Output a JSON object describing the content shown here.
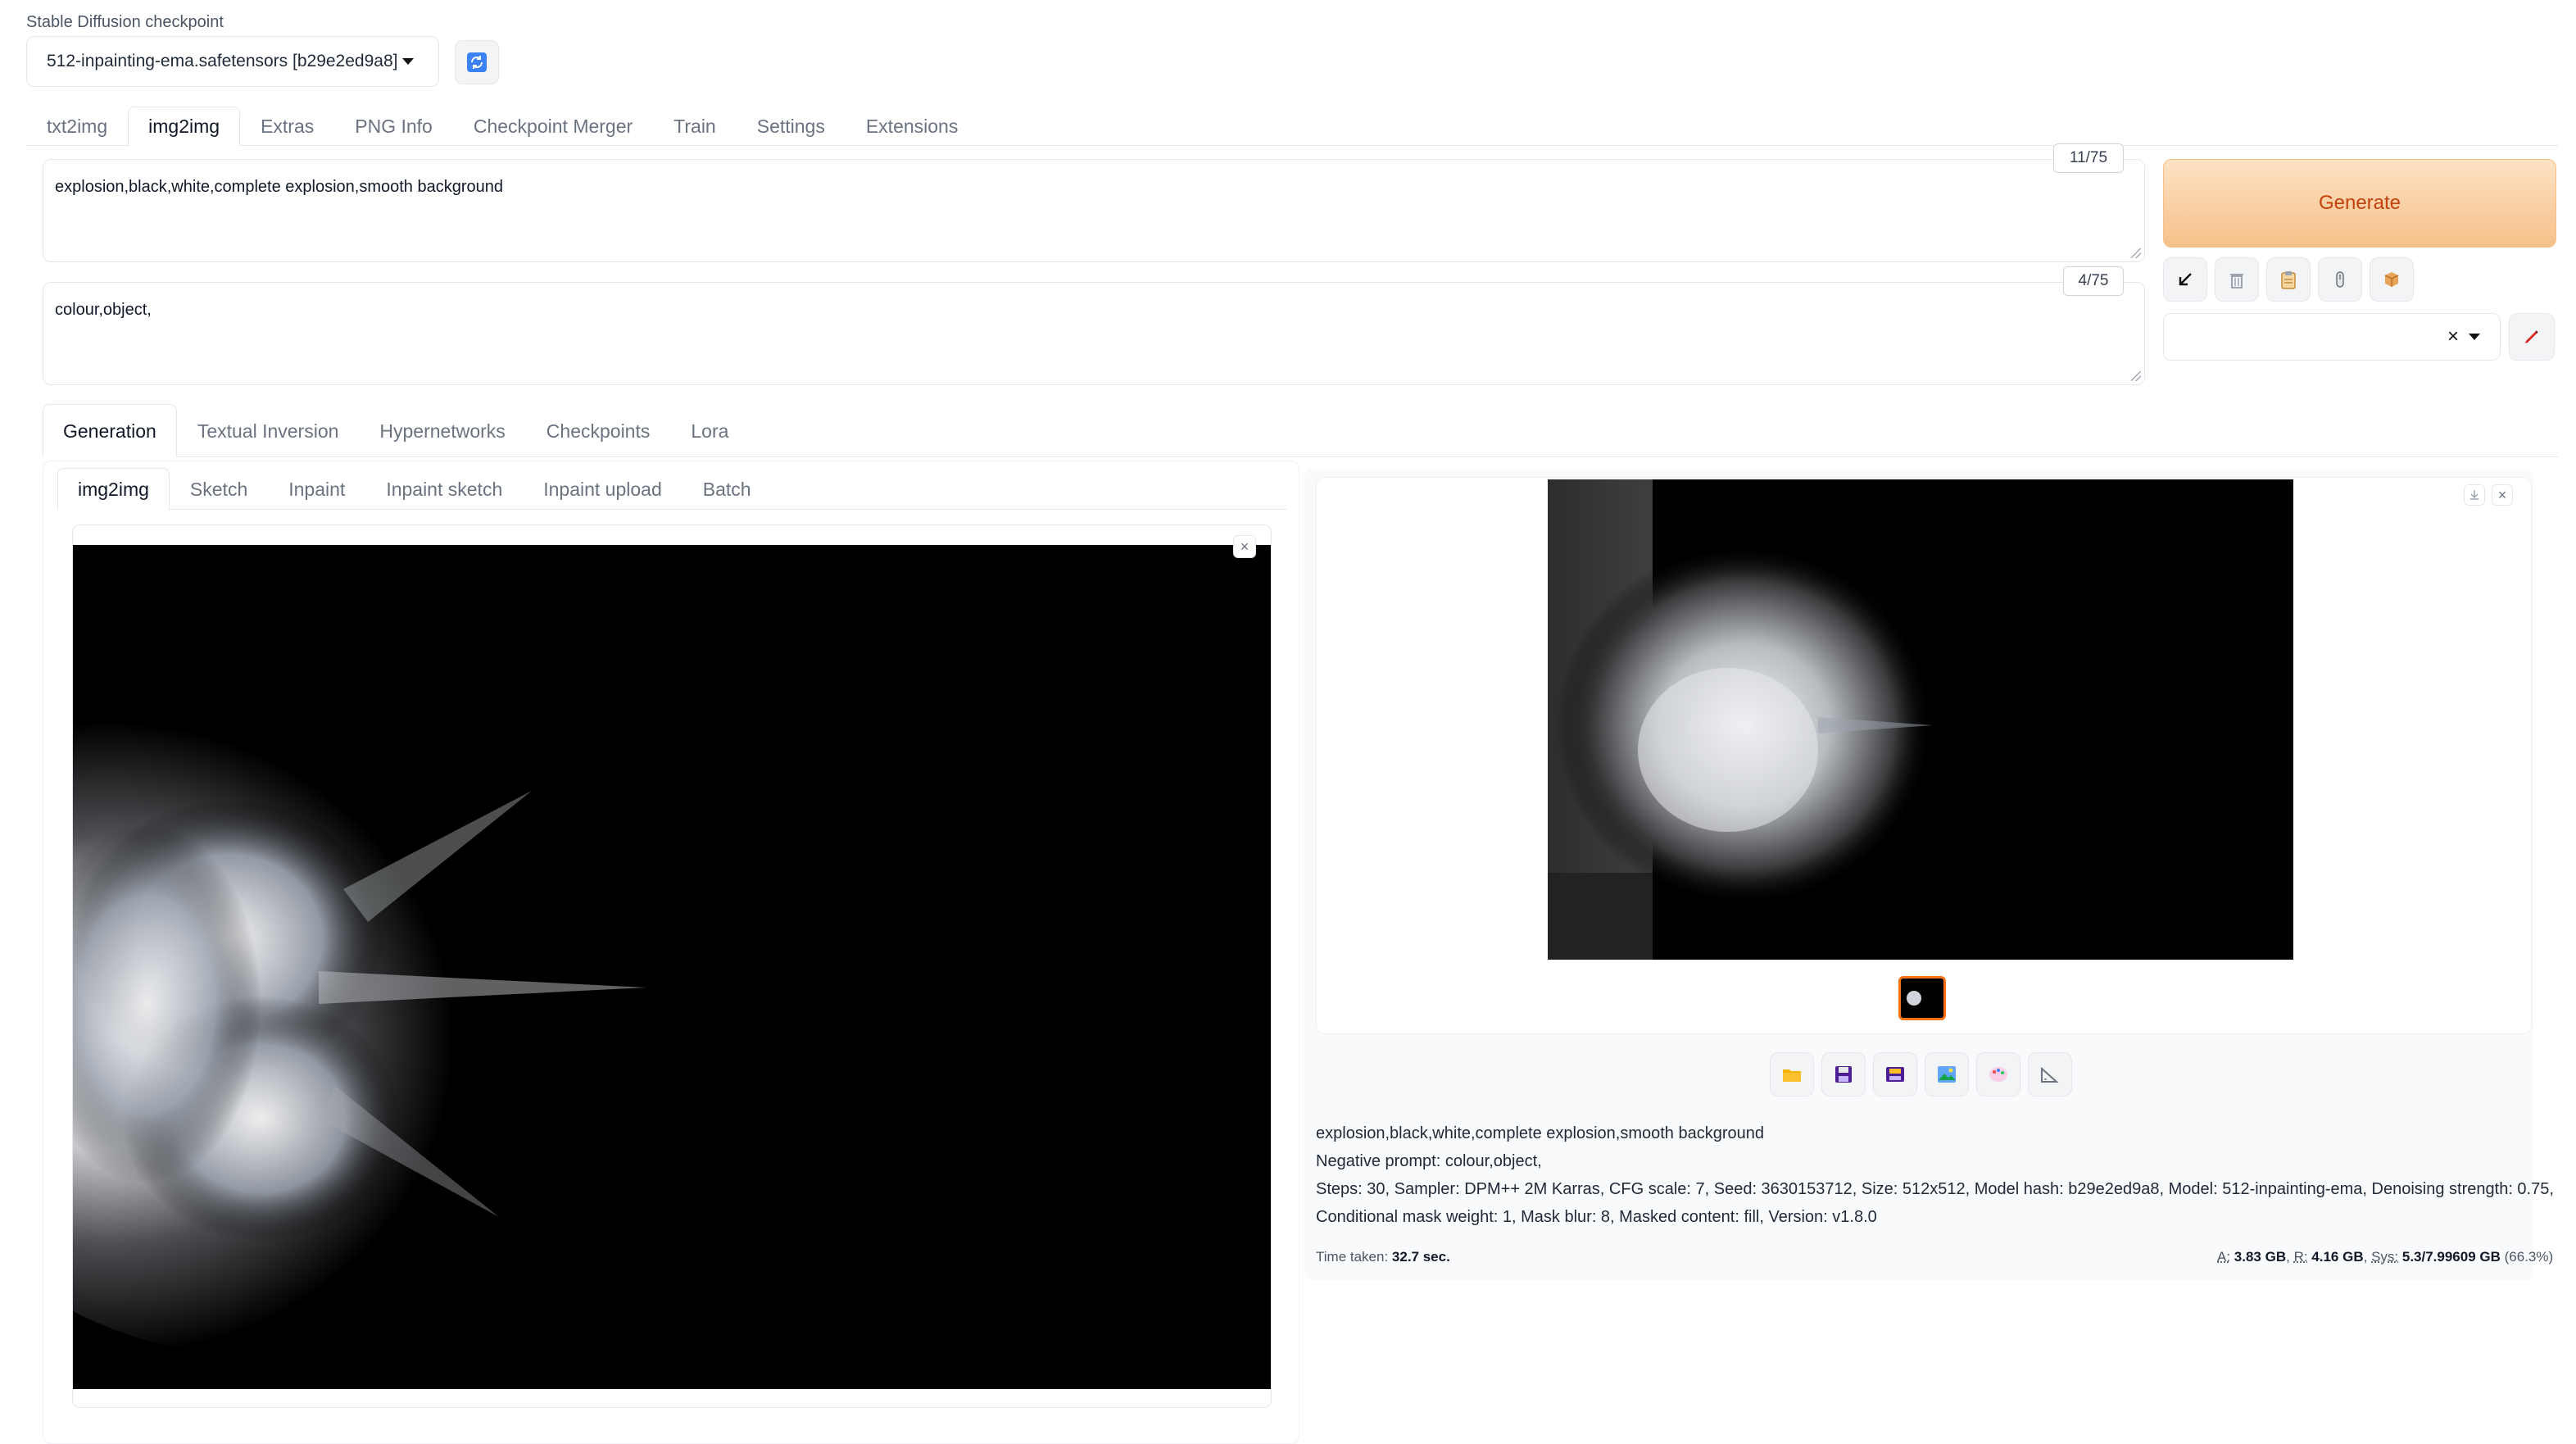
{
  "checkpoint": {
    "label": "Stable Diffusion checkpoint",
    "value": "512-inpainting-ema.safetensors [b29e2ed9a8]",
    "refresh_icon": "refresh-icon"
  },
  "main_tabs": [
    "txt2img",
    "img2img",
    "Extras",
    "PNG Info",
    "Checkpoint Merger",
    "Train",
    "Settings",
    "Extensions"
  ],
  "prompt": {
    "value": "explosion,black,white,complete explosion,smooth background",
    "token_counter": "11/75"
  },
  "negative_prompt": {
    "value": "colour,object,",
    "token_counter": "4/75"
  },
  "generate": {
    "label": "Generate",
    "color": "#f6c48e"
  },
  "action_icons": [
    "arrow-icon",
    "trash-icon",
    "clipboard-icon",
    "paint-icon",
    "box-icon"
  ],
  "style_dropdown": {
    "value": "",
    "clear_icon": "×",
    "edit_icon": "pencil-icon"
  },
  "sub_tabs": [
    "Generation",
    "Textual Inversion",
    "Hypernetworks",
    "Checkpoints",
    "Lora"
  ],
  "mode_tabs": [
    "img2img",
    "Sketch",
    "Inpaint",
    "Inpaint sketch",
    "Inpaint upload",
    "Batch"
  ],
  "input_image": {
    "close_label": "×"
  },
  "output": {
    "download_icon": "download-icon",
    "close_label": "×",
    "thumb_border_color": "#f97316",
    "tool_icons": [
      "folder-icon",
      "save-icon",
      "zip-icon",
      "image-icon",
      "palette-icon",
      "ruler-icon"
    ],
    "info_lines": [
      "explosion,black,white,complete explosion,smooth background",
      "Negative prompt: colour,object,",
      "Steps: 30, Sampler: DPM++ 2M Karras, CFG scale: 7, Seed: 3630153712, Size: 512x512, Model hash: b29e2ed9a8, Model: 512-inpainting-ema, Denoising strength: 0.75,",
      "Conditional mask weight: 1, Mask blur: 8, Masked content: fill, Version: v1.8.0"
    ],
    "time_label": "Time taken:",
    "time_value": "32.7 sec.",
    "mem": {
      "a_label": "A:",
      "a_value": "3.83 GB",
      "r_label": "R:",
      "r_value": "4.16 GB",
      "sys_label": "Sys:",
      "sys_value": "5.3/7.99609 GB",
      "sys_pct": "(66.3%)"
    }
  }
}
